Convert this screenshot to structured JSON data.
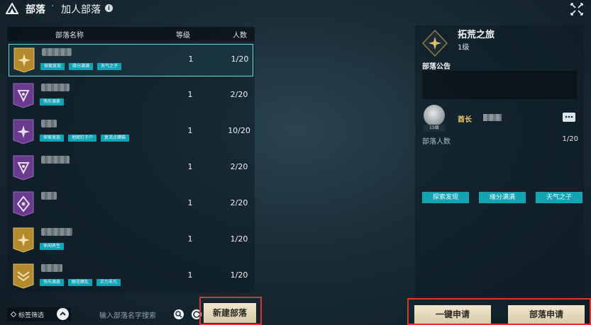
{
  "header": {
    "title": "部落",
    "separator": "·",
    "subtitle": "加人部落",
    "info_icon": "i"
  },
  "table": {
    "columns": {
      "name": "部落名称",
      "level": "等级",
      "members": "人数"
    },
    "rows": [
      {
        "level": "1",
        "members": "1/20",
        "banner": "gold",
        "tags": [
          "探索发现",
          "缘分满满",
          "天气之子"
        ]
      },
      {
        "level": "1",
        "members": "2/20",
        "banner": "purple",
        "tags": [
          "快乐源泉"
        ]
      },
      {
        "level": "1",
        "members": "10/20",
        "banner": "purple",
        "tags": [
          "探索发现",
          "地图钉子户",
          "复活点蹲猫"
        ]
      },
      {
        "level": "1",
        "members": "2/20",
        "banner": "purple",
        "tags": []
      },
      {
        "level": "1",
        "members": "2/20",
        "banner": "purple",
        "tags": []
      },
      {
        "level": "1",
        "members": "1/20",
        "banner": "gold",
        "tags": [
          "休闲养生"
        ]
      },
      {
        "level": "1",
        "members": "1/20",
        "banner": "gold",
        "tags": [
          "快乐源泉",
          "眼花缭乱",
          "实力非凡"
        ]
      }
    ]
  },
  "footer": {
    "filter_label": "标签筛选",
    "search_placeholder": "输入部落名字搜索",
    "new_button": "新建部落"
  },
  "detail": {
    "name": "拓荒之旅",
    "level": "1级",
    "notice_label": "部落公告",
    "notice_text": "",
    "leader_level": "15级",
    "leader_role": "酋长",
    "members_label": "部落人数",
    "members_value": "1/20",
    "tags": [
      "探索发现",
      "缘分满满",
      "天气之子"
    ]
  },
  "actions": {
    "one_click_apply": "一键申请",
    "apply": "部落申请"
  },
  "colors": {
    "accent_tag": "#10a4b4",
    "selected_border": "#6ad8e6",
    "highlight_frame": "#d9362f",
    "button_bg": "#e9dec2"
  }
}
